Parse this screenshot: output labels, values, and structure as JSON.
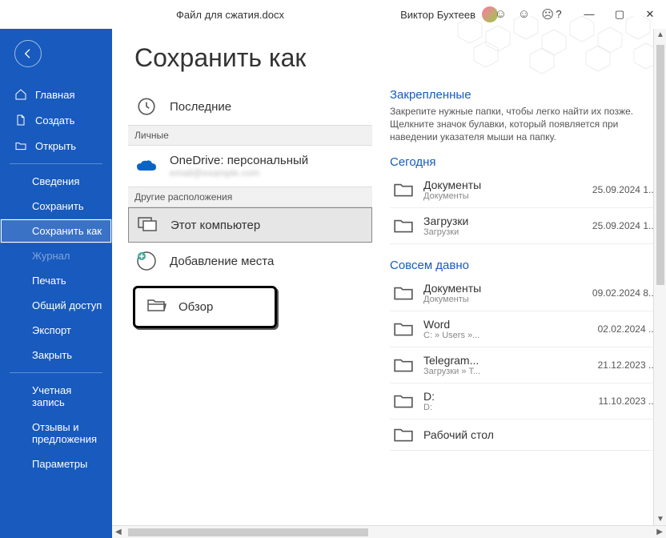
{
  "titlebar": {
    "filename": "Файл для сжатия.docx",
    "username": "Виктор Бухтеев"
  },
  "sidebar": {
    "home": "Главная",
    "new": "Создать",
    "open": "Открыть",
    "info": "Сведения",
    "save": "Сохранить",
    "saveas": "Сохранить как",
    "history": "Журнал",
    "print": "Печать",
    "share": "Общий доступ",
    "export": "Экспорт",
    "close": "Закрыть",
    "account": "Учетная запись",
    "feedback": "Отзывы и предложения",
    "options": "Параметры"
  },
  "page": {
    "title": "Сохранить как"
  },
  "locations": {
    "recent": "Последние",
    "personal_header": "Личные",
    "onedrive": "OneDrive: персональный",
    "onedrive_sub": "email@example.com",
    "other_header": "Другие расположения",
    "thispc": "Этот компьютер",
    "addplace": "Добавление места",
    "browse": "Обзор"
  },
  "folders": {
    "pinned_title": "Закрепленные",
    "pinned_desc": "Закрепите нужные папки, чтобы легко найти их позже. Щелкните значок булавки, который появляется при наведении указателя мыши на папку.",
    "today_title": "Сегодня",
    "longago_title": "Совсем давно",
    "today": [
      {
        "name": "Документы",
        "sub": "Документы",
        "date": "25.09.2024 1..."
      },
      {
        "name": "Загрузки",
        "sub": "Загрузки",
        "date": "25.09.2024 1..."
      }
    ],
    "longago": [
      {
        "name": "Документы",
        "sub": "Документы",
        "date": "09.02.2024 8..."
      },
      {
        "name": "Word",
        "sub": "C: » Users »...",
        "date": "02.02.2024 ..."
      },
      {
        "name": "Telegram...",
        "sub": "Загрузки » T...",
        "date": "21.12.2023 ..."
      },
      {
        "name": "D:",
        "sub": "D:",
        "date": "11.10.2023 ..."
      },
      {
        "name": "Рабочий стол",
        "sub": "",
        "date": ""
      }
    ]
  }
}
